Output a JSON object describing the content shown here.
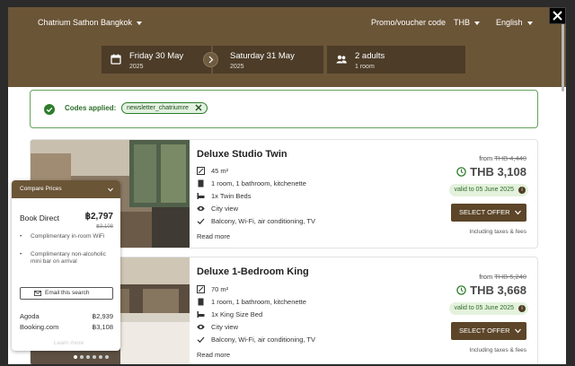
{
  "header": {
    "hotel": "Chatrium Sathon Bangkok",
    "promo": "Promo/voucher code",
    "currency": "THB",
    "language": "English"
  },
  "dates": {
    "checkin_day": "Friday 30 May",
    "checkin_year": "2025",
    "checkout_day": "Saturday 31 May",
    "checkout_year": "2025",
    "guests": "2 adults",
    "rooms": "1 room"
  },
  "codes": {
    "label": "Codes applied:",
    "chip": "newsletter_chatriumre"
  },
  "rooms": [
    {
      "title": "Deluxe Studio Twin",
      "size": "45 m²",
      "layout": "1 room, 1 bathroom, kitchenette",
      "beds": "1x Twin Beds",
      "view": "City view",
      "amenities": "Balcony, Wi-Fi, air conditioning, TV",
      "more": "Read more",
      "from": "from",
      "old_price": "THB 4,440",
      "price": "THB 3,108",
      "valid": "valid to 05 June 2025",
      "select": "SELECT OFFER",
      "taxes": "Including taxes & fees"
    },
    {
      "title": "Deluxe 1-Bedroom King",
      "size": "70 m²",
      "layout": "1 room, 1 bathroom, kitchenette",
      "beds": "1x King Size Bed",
      "view": "City view",
      "amenities": "Balcony, Wi-Fi, air conditioning, TV",
      "more": "Read more",
      "from": "from",
      "old_price": "THB 5,240",
      "price": "THB 3,668",
      "valid": "valid to 05 June 2025",
      "select": "SELECT OFFER",
      "taxes": "Including taxes & fees"
    }
  ],
  "compare": {
    "title": "Compare Prices",
    "book_direct": "Book Direct",
    "direct_price": "฿2,797",
    "direct_old": "฿3,108",
    "perks": [
      "Complimentary in-room WiFi",
      "Complimentary non-alcoholic mini bar on arrival"
    ],
    "email": "Email this search",
    "others": [
      {
        "name": "Agoda",
        "price": "฿2,939"
      },
      {
        "name": "Booking.com",
        "price": "฿3,108"
      }
    ],
    "learn": "Learn more"
  },
  "colors": {
    "brand": "#6b5537",
    "brand_dark": "#4c3c28",
    "button": "#5c4528",
    "success": "#2d7d2b"
  }
}
